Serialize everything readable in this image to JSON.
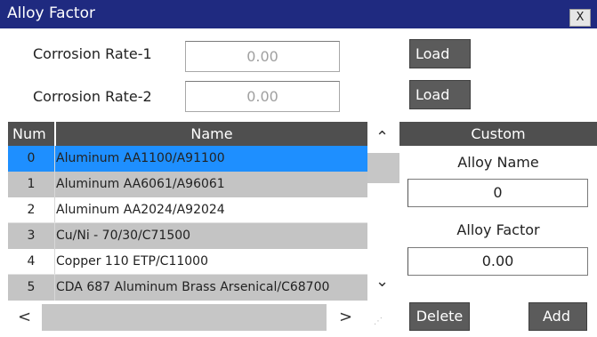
{
  "window": {
    "title": "Alloy Factor",
    "close_label": "X"
  },
  "corrosion": [
    {
      "label": "Corrosion Rate-1",
      "value": "0.00",
      "button": "Load"
    },
    {
      "label": "Corrosion Rate-2",
      "value": "0.00",
      "button": "Load"
    }
  ],
  "table": {
    "headers": {
      "num": "Num",
      "name": "Name"
    },
    "rows": [
      {
        "num": "0",
        "name": "Aluminum AA1100/A91100"
      },
      {
        "num": "1",
        "name": "Aluminum AA6061/A96061"
      },
      {
        "num": "2",
        "name": "Aluminum AA2024/A92024"
      },
      {
        "num": "3",
        "name": "Cu/Ni - 70/30/C71500"
      },
      {
        "num": "4",
        "name": "Copper 110 ETP/C11000"
      },
      {
        "num": "5",
        "name": "CDA 687 Aluminum Brass Arsenical/C68700"
      }
    ],
    "selected_index": 0
  },
  "scroll": {
    "up": "⌃",
    "down": "⌄",
    "left": "<",
    "right": ">",
    "grip": "⋰"
  },
  "custom": {
    "header": "Custom",
    "alloy_name_label": "Alloy Name",
    "alloy_name_value": "0",
    "alloy_factor_label": "Alloy Factor",
    "alloy_factor_value": "0.00",
    "delete_label": "Delete",
    "add_label": "Add"
  },
  "colors": {
    "titlebar": "#1f2a80",
    "selected": "#1e8fff",
    "header": "#4f4f4f",
    "button": "#5b5b5b"
  }
}
